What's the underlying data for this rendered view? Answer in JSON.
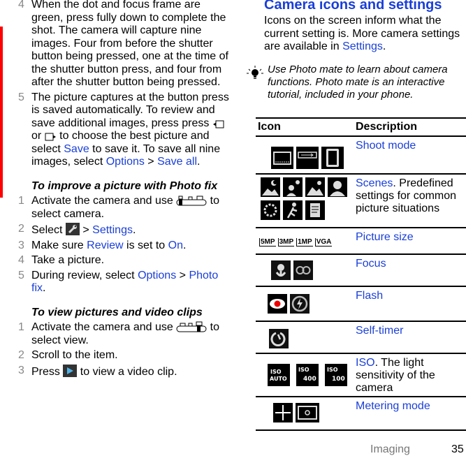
{
  "page": {
    "section": "Imaging",
    "page_number": "35",
    "accent_color": "#1a3fd8",
    "margin_marker_color": "#ff0000"
  },
  "left": {
    "step4": {
      "num": "4",
      "text": "When the dot and focus frame are green, press fully down to complete the shot. The camera will capture nine images. Four from before the shutter button being pressed, one at the time of the shutter button press, and four from after the shutter button being pressed."
    },
    "step5": {
      "num": "5",
      "t1": "The picture captures at the button press is saved automatically. To review and save additional images, press press ",
      "t2": " or ",
      "t3": " to choose the best picture and select ",
      "save": "Save",
      "t4": " to save it. To save all nine images, select ",
      "options": "Options",
      "sep": " > ",
      "save_all": "Save all",
      "end": "."
    },
    "photofix": {
      "heading": "To improve a picture with Photo fix",
      "steps": [
        {
          "num": "1",
          "t1": "Activate the camera and use ",
          "t2": " to select camera."
        },
        {
          "num": "2",
          "t1": "Select ",
          "t2": " > ",
          "link": "Settings",
          "end": "."
        },
        {
          "num": "3",
          "t1": "Make sure ",
          "link1": "Review",
          "t2": " is set to ",
          "link2": "On",
          "end": "."
        },
        {
          "num": "4",
          "t1": "Take a picture."
        },
        {
          "num": "5",
          "t1": "During review, select ",
          "link1": "Options",
          "t2": " > ",
          "link2": "Photo fix",
          "end": "."
        }
      ]
    },
    "viewclips": {
      "heading": "To view pictures and video clips",
      "steps": [
        {
          "num": "1",
          "t1": "Activate the camera and use ",
          "t2": " to select view."
        },
        {
          "num": "2",
          "t1": "Scroll to the item."
        },
        {
          "num": "3",
          "t1": "Press ",
          "t2": " to view a video clip."
        }
      ]
    }
  },
  "right": {
    "title": "Camera icons and settings",
    "intro": "Icons on the screen inform what the current setting is. More camera settings are available in ",
    "intro_link": "Settings",
    "intro_end": ".",
    "tip": "Use Photo mate to learn about camera functions. Photo mate is an interactive tutorial, included in your phone.",
    "table": {
      "headers": [
        "Icon",
        "Description"
      ],
      "rows": [
        {
          "icons": [
            "shoot-mode-normal-icon",
            "shoot-mode-panorama-icon",
            "shoot-mode-portrait-icon"
          ],
          "link": "Shoot mode",
          "text": ""
        },
        {
          "icons": [
            "scene-night-landscape-icon",
            "scene-night-portrait-icon",
            "scene-landscape-icon",
            "scene-portrait-icon",
            "scene-snow-icon",
            "scene-sports-icon",
            "scene-document-icon"
          ],
          "link": "Scenes",
          "text": ". Predefined settings for common picture situations"
        },
        {
          "icons": [
            "5MP",
            "3MP",
            "1MP",
            "VGA"
          ],
          "link": "Picture size",
          "text": ""
        },
        {
          "icons": [
            "focus-macro-icon",
            "focus-infinite-icon"
          ],
          "link": "Focus",
          "text": ""
        },
        {
          "icons": [
            "flash-red-eye-icon",
            "flash-off-icon"
          ],
          "link": "Flash",
          "text": ""
        },
        {
          "icons": [
            "self-timer-icon"
          ],
          "link": "Self-timer",
          "text": ""
        },
        {
          "icons": [
            "ISO AUTO",
            "ISO 400",
            "ISO 100"
          ],
          "link": "ISO",
          "text": ". The light sensitivity of the camera"
        },
        {
          "icons": [
            "metering-center-icon",
            "metering-spot-icon"
          ],
          "link": "Metering mode",
          "text": ""
        }
      ]
    }
  }
}
